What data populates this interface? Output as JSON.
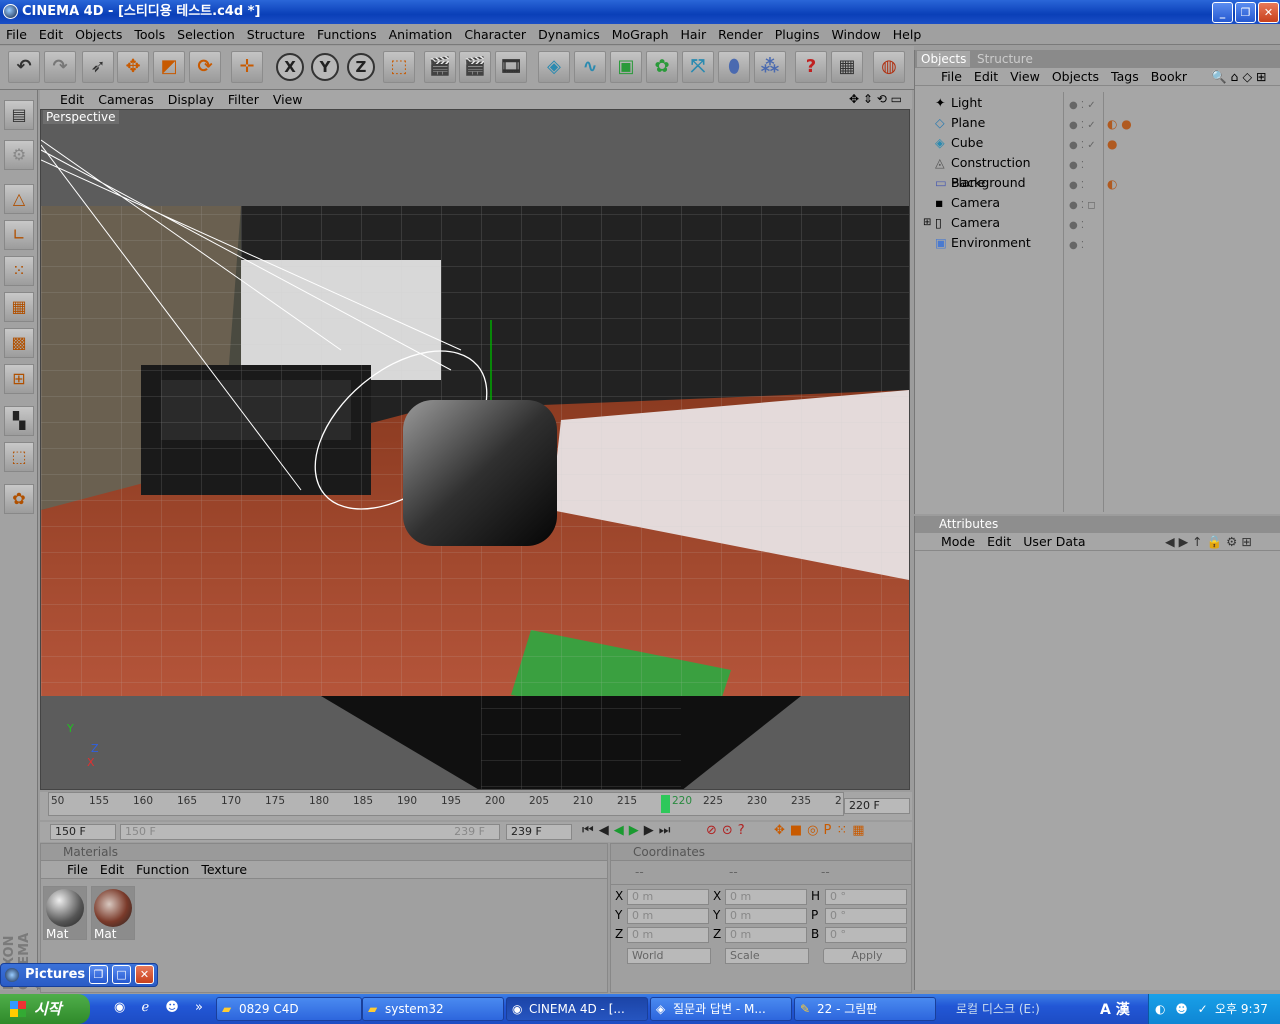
{
  "window": {
    "title": "CINEMA 4D - [스티디용 테스트.c4d *]"
  },
  "menubar": [
    "File",
    "Edit",
    "Objects",
    "Tools",
    "Selection",
    "Structure",
    "Functions",
    "Animation",
    "Character",
    "Dynamics",
    "MoGraph",
    "Hair",
    "Render",
    "Plugins",
    "Window",
    "Help"
  ],
  "viewport": {
    "menu": [
      "Edit",
      "Cameras",
      "Display",
      "Filter",
      "View"
    ],
    "label": "Perspective",
    "axis_x": "X",
    "axis_y": "Y",
    "axis_z": "Z"
  },
  "timeline": {
    "ticks": [
      "50",
      "155",
      "160",
      "165",
      "170",
      "175",
      "180",
      "185",
      "190",
      "195",
      "200",
      "205",
      "210",
      "215",
      "220",
      "225",
      "230",
      "235",
      "2"
    ],
    "current": "220",
    "current_field": "220 F",
    "start_field": "150 F",
    "range_start": "150 F",
    "range_end": "239 F",
    "end_field": "239 F"
  },
  "materials": {
    "title": "Materials",
    "menu": [
      "File",
      "Edit",
      "Function",
      "Texture"
    ],
    "items": [
      {
        "label": "Mat"
      },
      {
        "label": "Mat"
      }
    ]
  },
  "coordinates": {
    "title": "Coordinates",
    "headers": [
      "--",
      "--",
      "--"
    ],
    "rows": [
      {
        "a": "X",
        "av": "0 m",
        "b": "X",
        "bv": "0 m",
        "c": "H",
        "cv": "0 °"
      },
      {
        "a": "Y",
        "av": "0 m",
        "b": "Y",
        "bv": "0 m",
        "c": "P",
        "cv": "0 °"
      },
      {
        "a": "Z",
        "av": "0 m",
        "b": "Z",
        "bv": "0 m",
        "c": "B",
        "cv": "0 °"
      }
    ],
    "mode": "World",
    "scale": "Scale",
    "apply": "Apply"
  },
  "objects": {
    "tabs": [
      "Objects",
      "Structure"
    ],
    "menu": [
      "File",
      "Edit",
      "View",
      "Objects",
      "Tags",
      "Bookr"
    ],
    "items": [
      "Light",
      "Plane",
      "Cube",
      "Construction Plane",
      "Background",
      "Camera",
      "Camera",
      "Environment"
    ]
  },
  "attributes": {
    "title": "Attributes",
    "menu": [
      "Mode",
      "Edit",
      "User Data"
    ]
  },
  "pictures_bar": {
    "label": "Pictures"
  },
  "side_logo": "MAXON CINEMA 4D",
  "taskbar": {
    "start": "시작",
    "tasks": [
      "0829 C4D",
      "system32",
      "CINEMA 4D - [...",
      "질문과 답변 - M...",
      "22 - 그림판"
    ],
    "disk": "로컬 디스크 (E:)",
    "ime": "A 漢",
    "clock": "오후 9:37"
  },
  "colors": {
    "title_blue": "#0a3fb8",
    "panel_gray": "#a6a6a6",
    "taskbar_blue": "#2257d6",
    "start_green": "#2f8a2a",
    "tool_orange": "#c85a00"
  }
}
